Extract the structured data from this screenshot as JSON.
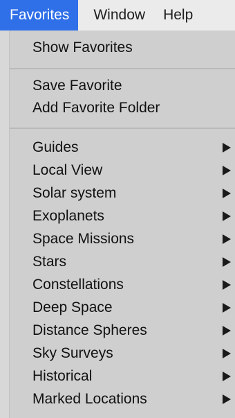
{
  "menubar": {
    "favorites": "Favorites",
    "window": "Window",
    "help": "Help"
  },
  "menu": {
    "show_favorites": "Show Favorites",
    "save_favorite": "Save Favorite",
    "add_favorite_folder": "Add Favorite Folder",
    "submenu_items": [
      {
        "label": "Guides",
        "icon": "submenu-arrow-icon"
      },
      {
        "label": "Local View",
        "icon": "submenu-arrow-icon"
      },
      {
        "label": "Solar system",
        "icon": "submenu-arrow-icon"
      },
      {
        "label": "Exoplanets",
        "icon": "submenu-arrow-icon"
      },
      {
        "label": "Space Missions",
        "icon": "submenu-arrow-icon"
      },
      {
        "label": "Stars",
        "icon": "submenu-arrow-icon"
      },
      {
        "label": "Constellations",
        "icon": "submenu-arrow-icon"
      },
      {
        "label": "Deep Space",
        "icon": "submenu-arrow-icon"
      },
      {
        "label": "Distance Spheres",
        "icon": "submenu-arrow-icon"
      },
      {
        "label": "Sky Surveys",
        "icon": "submenu-arrow-icon"
      },
      {
        "label": "Historical",
        "icon": "submenu-arrow-icon"
      },
      {
        "label": "Marked Locations",
        "icon": "submenu-arrow-icon"
      }
    ]
  },
  "colors": {
    "active_menu": "#2f6fe8",
    "menu_background": "#cfcfcf",
    "menubar_background": "#ebebeb"
  }
}
